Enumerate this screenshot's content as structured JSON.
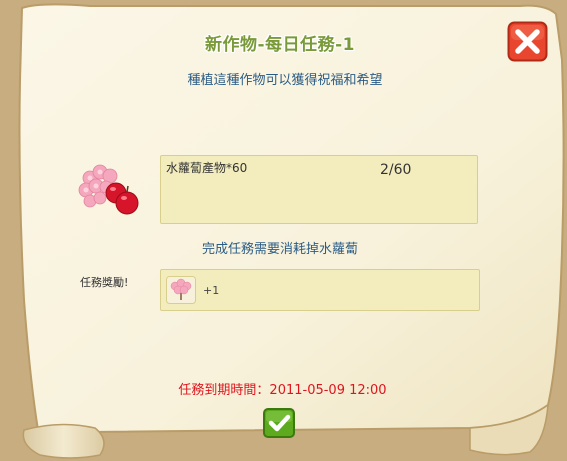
{
  "dialog": {
    "title": "新作物-每日任務-1",
    "subtitle": "種植這種作物可以獲得祝福和希望"
  },
  "requirement": {
    "item": "水蘿蔔產物*60",
    "progress": "2/60",
    "icon": "cherry-blossom-apple-icon"
  },
  "note": "完成任務需要消耗掉水蘿蔔",
  "reward": {
    "label": "任務獎勵!",
    "quantity": "+1",
    "icon": "cherry-blossom-icon"
  },
  "expiry": {
    "label": "任務到期時間：",
    "datetime": "2011-05-09 12:00"
  },
  "buttons": {
    "close_icon": "close-icon",
    "confirm_icon": "checkmark-icon"
  },
  "colors": {
    "title_green": "#7a9a3a",
    "text_blue": "#2b5c86",
    "expire_red": "#e0141e",
    "box_fill": "#f3edbe",
    "close_red": "#e8462f",
    "confirm_green": "#5daa1f"
  }
}
